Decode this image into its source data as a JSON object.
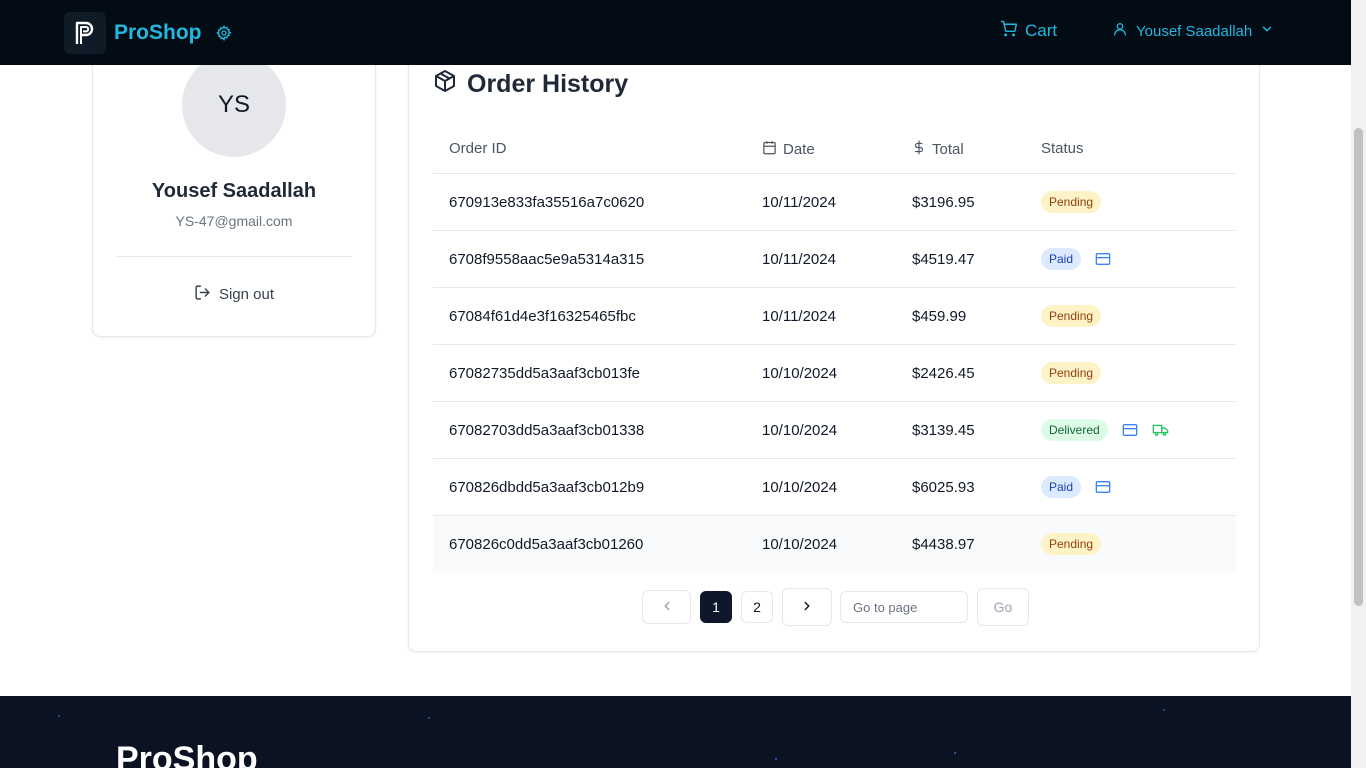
{
  "header": {
    "brand": "ProShop",
    "cart_label": "Cart",
    "user_name": "Yousef Saadallah"
  },
  "profile": {
    "initials": "YS",
    "name": "Yousef Saadallah",
    "email": "YS-47@gmail.com",
    "signout_label": "Sign out"
  },
  "orders": {
    "title": "Order History",
    "columns": {
      "id": "Order ID",
      "date": "Date",
      "total": "Total",
      "status": "Status"
    },
    "rows": [
      {
        "id": "670913e833fa35516a7c0620",
        "date": "10/11/2024",
        "total": "$3196.95",
        "status": "Pending",
        "status_type": "pending",
        "icons": []
      },
      {
        "id": "6708f9558aac5e9a5314a315",
        "date": "10/11/2024",
        "total": "$4519.47",
        "status": "Paid",
        "status_type": "paid",
        "icons": [
          "credit-card-icon"
        ]
      },
      {
        "id": "67084f61d4e3f16325465fbc",
        "date": "10/11/2024",
        "total": "$459.99",
        "status": "Pending",
        "status_type": "pending",
        "icons": []
      },
      {
        "id": "67082735dd5a3aaf3cb013fe",
        "date": "10/10/2024",
        "total": "$2426.45",
        "status": "Pending",
        "status_type": "pending",
        "icons": []
      },
      {
        "id": "67082703dd5a3aaf3cb01338",
        "date": "10/10/2024",
        "total": "$3139.45",
        "status": "Delivered",
        "status_type": "delivered",
        "icons": [
          "credit-card-icon",
          "truck-icon"
        ]
      },
      {
        "id": "670826dbdd5a3aaf3cb012b9",
        "date": "10/10/2024",
        "total": "$6025.93",
        "status": "Paid",
        "status_type": "paid",
        "icons": [
          "credit-card-icon"
        ]
      },
      {
        "id": "670826c0dd5a3aaf3cb01260",
        "date": "10/10/2024",
        "total": "$4438.97",
        "status": "Pending",
        "status_type": "pending",
        "icons": []
      }
    ]
  },
  "pagination": {
    "pages": [
      "1",
      "2"
    ],
    "current_page": "1",
    "goto_placeholder": "Go to page",
    "go_label": "Go"
  },
  "footer": {
    "brand": "ProShop"
  },
  "colors": {
    "header_bg": "#030b14",
    "brand_accent": "#22b8e0",
    "pending_bg": "#fef3c7",
    "paid_bg": "#dbeafe",
    "delivered_bg": "#dcfce7"
  }
}
